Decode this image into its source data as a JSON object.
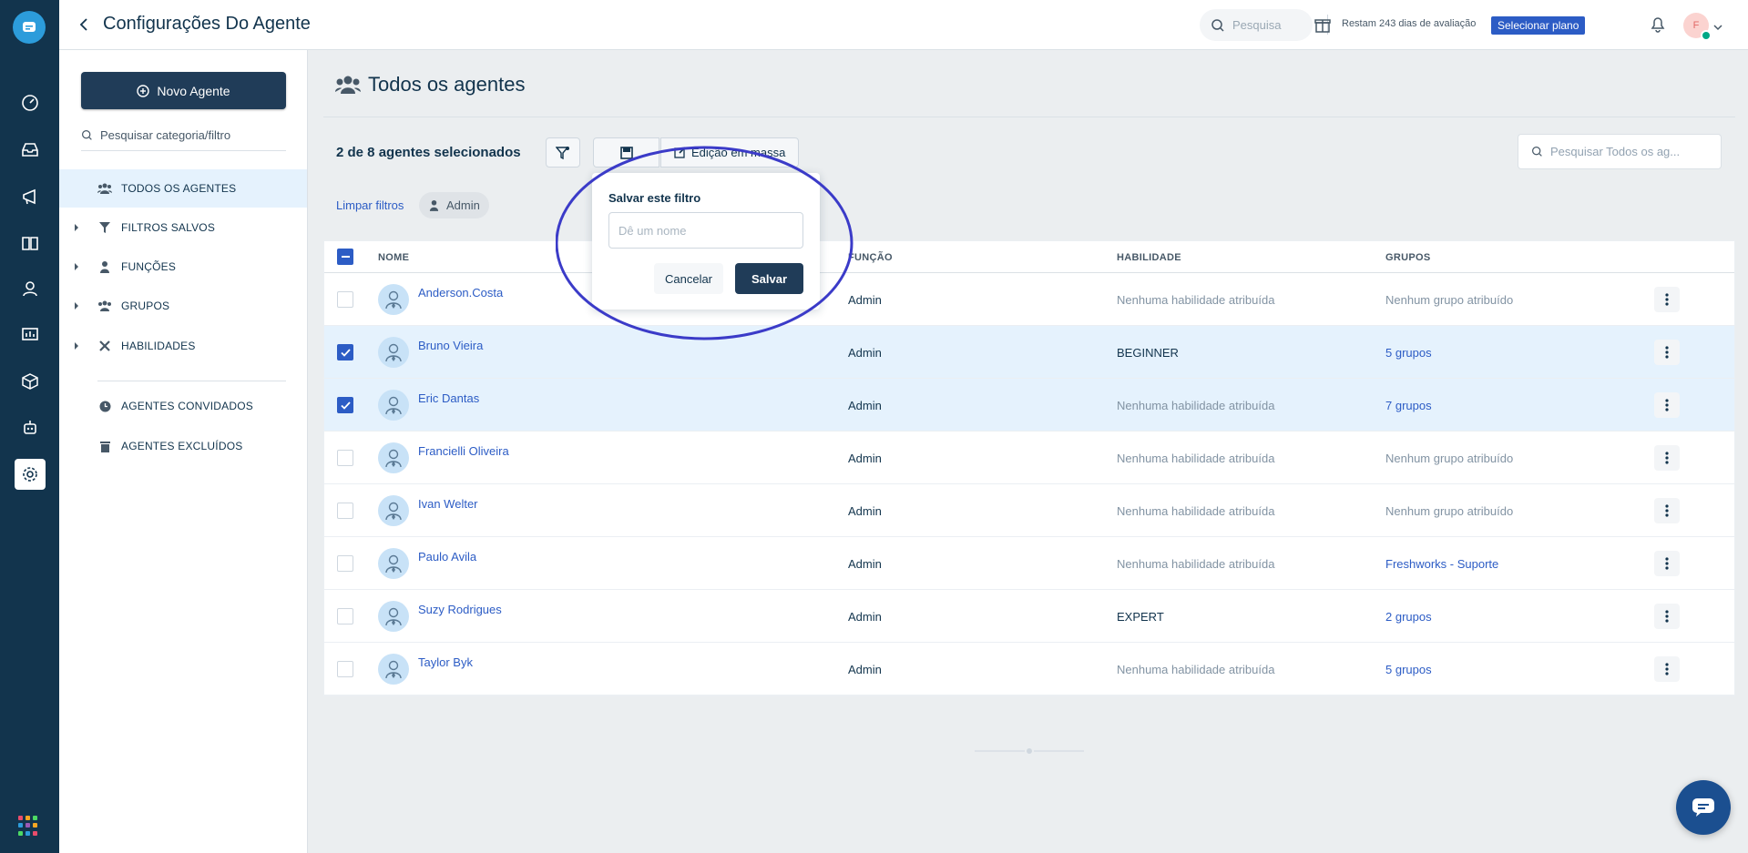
{
  "header": {
    "title": "Configurações Do Agente",
    "search_placeholder": "Pesquisa",
    "trial_text": "Restam 243 dias de avaliação",
    "plan_button": "Selecionar plano",
    "avatar_initial": "F"
  },
  "sidebar": {
    "new_agent_label": "Novo Agente",
    "search_placeholder": "Pesquisar categoria/filtro",
    "items": [
      {
        "label": "TODOS OS AGENTES",
        "icon": "users-icon",
        "active": true
      },
      {
        "label": "FILTROS SALVOS",
        "icon": "filter-icon",
        "expandable": true
      },
      {
        "label": "FUNÇÕES",
        "icon": "person-icon",
        "expandable": true
      },
      {
        "label": "GRUPOS",
        "icon": "users-icon",
        "expandable": true
      },
      {
        "label": "HABILIDADES",
        "icon": "tools-icon",
        "expandable": true
      },
      {
        "label": "AGENTES CONVIDADOS",
        "icon": "clock-icon"
      },
      {
        "label": "AGENTES EXCLUÍDOS",
        "icon": "trash-icon"
      }
    ]
  },
  "main": {
    "title": "Todos os agentes",
    "selected_count": "2 de 8 agentes selecionados",
    "bulk_edit_label": "Edição em massa",
    "clear_filters": "Limpar filtros",
    "filter_chip": "Admin",
    "search_placeholder": "Pesquisar Todos os ag..."
  },
  "table": {
    "columns": [
      "NOME",
      "FUNÇÃO",
      "HABILIDADE",
      "GRUPOS"
    ],
    "rows": [
      {
        "name": "Anderson.Costa",
        "role": "Admin",
        "skill": "Nenhuma habilidade atribuída",
        "groups": "Nenhum grupo atribuído",
        "selected": false
      },
      {
        "name": "Bruno Vieira",
        "role": "Admin",
        "skill": "BEGINNER",
        "groups": "5 grupos",
        "selected": true
      },
      {
        "name": "Eric Dantas",
        "role": "Admin",
        "skill": "Nenhuma habilidade atribuída",
        "groups": "7 grupos",
        "selected": true
      },
      {
        "name": "Francielli Oliveira",
        "role": "Admin",
        "skill": "Nenhuma habilidade atribuída",
        "groups": "Nenhum grupo atribuído",
        "selected": false
      },
      {
        "name": "Ivan Welter",
        "role": "Admin",
        "skill": "Nenhuma habilidade atribuída",
        "groups": "Nenhum grupo atribuído",
        "selected": false
      },
      {
        "name": "Paulo Avila",
        "role": "Admin",
        "skill": "Nenhuma habilidade atribuída",
        "groups": "Freshworks - Suporte",
        "selected": false
      },
      {
        "name": "Suzy Rodrigues",
        "role": "Admin",
        "skill": "EXPERT",
        "groups": "2 grupos",
        "selected": false
      },
      {
        "name": " Taylor Byk",
        "role": "Admin",
        "skill": "Nenhuma habilidade atribuída",
        "groups": "5 grupos",
        "selected": false
      }
    ]
  },
  "popover": {
    "title": "Salvar este filtro",
    "input_placeholder": "Dê um nome",
    "cancel_label": "Cancelar",
    "save_label": "Salvar"
  },
  "colors": {
    "rail": "#12344d",
    "primary_button": "#203c58",
    "link": "#2c5cc5",
    "selected_row": "#e5f2fd",
    "annotation": "#3b3bc8"
  }
}
